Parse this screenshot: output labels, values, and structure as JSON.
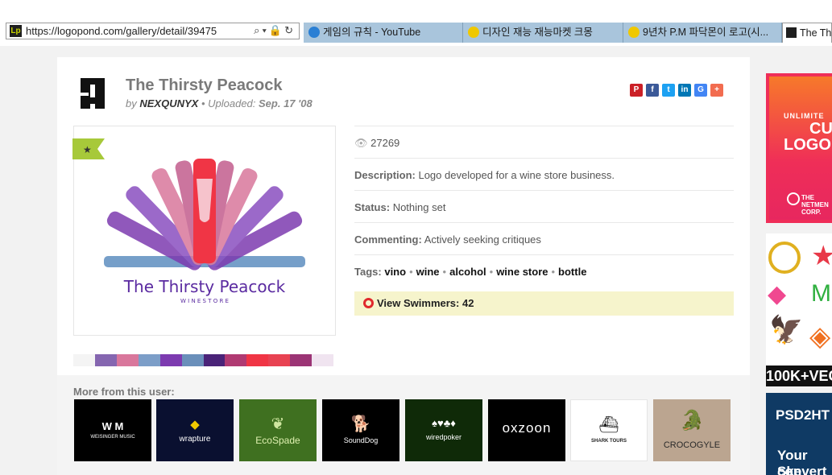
{
  "browser": {
    "url": "https://logopond.com/gallery/detail/39475",
    "favicon_text": "Lp",
    "tabs": [
      {
        "label": "게임의 규칙 - YouTube",
        "icon": "ie-icon",
        "color": "#2a7fd4"
      },
      {
        "label": "디자인 재능 재능마켓 크몽",
        "icon": "kmong-icon",
        "color": "#f0c800"
      },
      {
        "label": "9년차 P.M 파닥몬이 로고(시...",
        "icon": "kmong-icon",
        "color": "#f0c800"
      },
      {
        "label": "The Th",
        "icon": "logopond-icon",
        "color": "#1f1f1f"
      }
    ]
  },
  "logo": {
    "title": "The Thirsty Peacock",
    "by_prefix": "by",
    "author": "NEXQUNYX",
    "uploaded_prefix": "• Uploaded:",
    "uploaded_date": "Sep. 17 '08",
    "image_title": "The Thirsty Peacock",
    "image_subtitle": "W I N E S T O R E"
  },
  "share": [
    {
      "label": "P",
      "color": "#cb2027",
      "name": "pinterest-icon"
    },
    {
      "label": "f",
      "color": "#3b5998",
      "name": "facebook-icon"
    },
    {
      "label": "t",
      "color": "#1da1f2",
      "name": "twitter-icon"
    },
    {
      "label": "in",
      "color": "#0077b5",
      "name": "linkedin-icon"
    },
    {
      "label": "G",
      "color": "#4285f4",
      "name": "google-icon"
    },
    {
      "label": "+",
      "color": "#f26c4f",
      "name": "plus-icon"
    }
  ],
  "meta": {
    "views": "27269",
    "description_label": "Description:",
    "description": "Logo developed for a wine store business.",
    "status_label": "Status:",
    "status": "Nothing set",
    "commenting_label": "Commenting:",
    "commenting": "Actively seeking critiques",
    "tags_label": "Tags:",
    "tags": [
      "vino",
      "wine",
      "alcohol",
      "wine store",
      "bottle"
    ],
    "swimmers": "View Swimmers: 42"
  },
  "palette": [
    "#f4f4f4",
    "#8566b0",
    "#d9779c",
    "#7c9ec8",
    "#7d3bb0",
    "#6a8fba",
    "#4a2378",
    "#b03a72",
    "#f03545",
    "#e84252",
    "#9b3475",
    "#f0e4f0"
  ],
  "more": {
    "label": "More from this user:",
    "thumbs": [
      {
        "label": "WEISINGER MUSIC",
        "bg": "#000000"
      },
      {
        "label": "wrapture",
        "bg": "#0a1030"
      },
      {
        "label": "EcoSpade",
        "bg": "#3f7020"
      },
      {
        "label": "SoundDog",
        "bg": "#000000"
      },
      {
        "label": "wiredpoker",
        "bg": "#0f2a08"
      },
      {
        "label": "oxzoon",
        "bg": "#000000"
      },
      {
        "label": "SHARK TOURS",
        "bg": "#ffffff"
      },
      {
        "label": "CROCOGYLE",
        "bg": "#bba590"
      }
    ]
  },
  "ads": {
    "ad1_line1": "UNLIMITE",
    "ad1_line2": "CU",
    "ad1_line3": "LOGO",
    "ad1_brand": "THE NETMEN CORP.",
    "ad2_footer": "100K+VEC",
    "ad3_line1": "PSD2HT",
    "ad3_line2": "Your Ske",
    "ad3_line3": "convert"
  }
}
